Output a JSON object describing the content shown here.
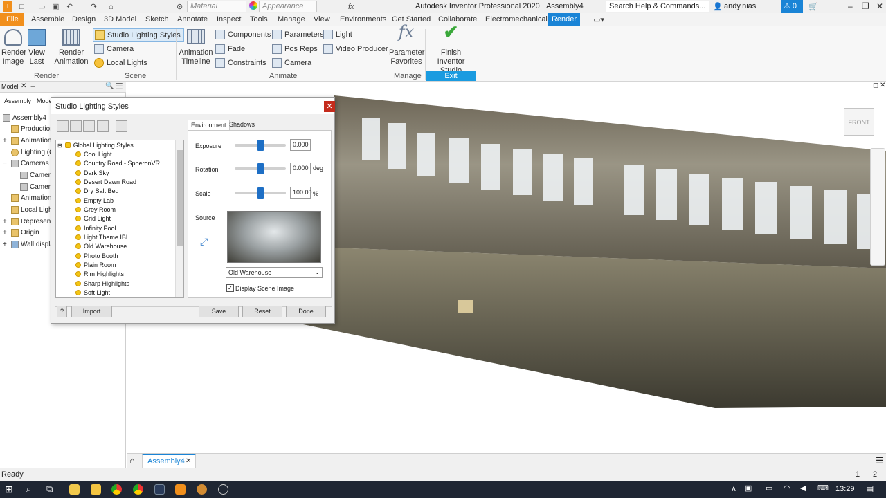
{
  "titlebar": {
    "material_placeholder": "Material",
    "appearance_placeholder": "Appearance",
    "app_title": "Autodesk Inventor Professional 2020",
    "doc_name": "Assembly4",
    "search_placeholder": "Search Help & Commands...",
    "user": "andy.nias",
    "notifications": "0"
  },
  "menu": {
    "file": "File",
    "items": [
      "Assemble",
      "Design",
      "3D Model",
      "Sketch",
      "Annotate",
      "Inspect",
      "Tools",
      "Manage",
      "View",
      "Environments",
      "Get Started",
      "Collaborate",
      "Electromechanical"
    ],
    "active": "Render"
  },
  "ribbon": {
    "render_image": "Render\nImage",
    "render_image_l1": "Render",
    "render_image_l2": "Image",
    "view_last_l1": "View",
    "view_last_l2": "Last",
    "render_anim_l1": "Render",
    "render_anim_l2": "Animation",
    "studio_lighting_styles": "Studio Lighting Styles",
    "camera": "Camera",
    "local_lights": "Local Lights",
    "anim_timeline_l1": "Animation",
    "anim_timeline_l2": "Timeline",
    "components": "Components",
    "fade": "Fade",
    "constraints": "Constraints",
    "parameters": "Parameters",
    "pos_reps": "Pos Reps",
    "camera2": "Camera",
    "light": "Light",
    "video_producer": "Video Producer",
    "param_fav_l1": "Parameter",
    "param_fav_l2": "Favorites",
    "finish_l1": "Finish",
    "finish_l2": "Inventor Studio",
    "panel_render": "Render",
    "panel_scene": "Scene",
    "panel_animate": "Animate",
    "panel_manage": "Manage",
    "panel_exit": "Exit"
  },
  "browser": {
    "tab_model": "Model",
    "sub_assembly": "Assembly",
    "sub_model": "Mode",
    "rows": [
      "Assembly4",
      "Productions",
      "Animations",
      "Lighting (O",
      "Cameras",
      "Camera",
      "Camera",
      "Animation I",
      "Local Lights",
      "Represent",
      "Origin",
      "Wall displa"
    ]
  },
  "dialog": {
    "title": "Studio Lighting Styles",
    "root": "Global Lighting Styles",
    "styles": [
      "Cool Light",
      "Country Road - SpheronVR",
      "Dark Sky",
      "Desert Dawn Road",
      "Dry Salt Bed",
      "Empty Lab",
      "Grey Room",
      "Grid Light",
      "Infinity Pool",
      "Light Theme IBL",
      "Old Warehouse",
      "Photo Booth",
      "Plain Room",
      "Rim Highlights",
      "Sharp Highlights",
      "Soft Light"
    ],
    "tab_environment": "Environment",
    "tab_shadows": "Shadows",
    "exposure_label": "Exposure",
    "exposure_value": "0.000",
    "rotation_label": "Rotation",
    "rotation_value": "0.000",
    "rotation_unit": "deg",
    "scale_label": "Scale",
    "scale_value": "100.00",
    "scale_unit": "%",
    "source_label": "Source",
    "source_selected": "Old Warehouse",
    "display_scene_image": "Display Scene Image",
    "import": "Import",
    "save": "Save",
    "reset": "Reset",
    "done": "Done"
  },
  "viewcube": {
    "face": "FRONT"
  },
  "doctab": {
    "name": "Assembly4"
  },
  "status": {
    "text": "Ready",
    "n1": "1",
    "n2": "2"
  },
  "taskbar": {
    "time": "13:29"
  },
  "colors": {
    "accent": "#1a84d6",
    "file_tab": "#f18f1c",
    "exit": "#1a9be0"
  }
}
